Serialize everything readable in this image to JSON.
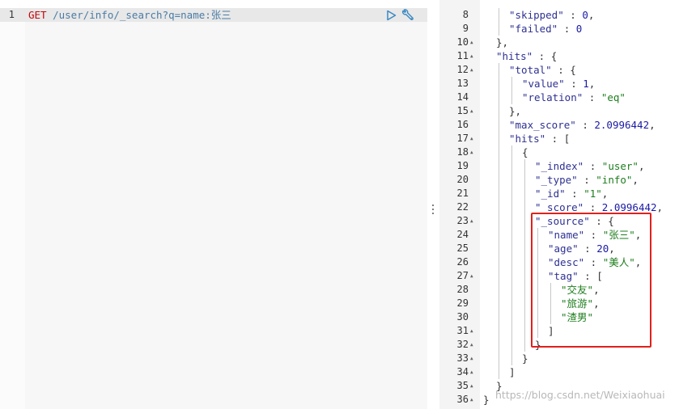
{
  "request": {
    "line_number": "1",
    "method": "GET",
    "path": " /user/info/_search?q=name:张三"
  },
  "icons": {
    "run": "play-icon",
    "settings": "wrench-icon"
  },
  "response": {
    "lines": [
      {
        "n": "8",
        "fold": false,
        "indent": 1,
        "tokens": [
          {
            "t": "\"skipped\"",
            "c": "key"
          },
          {
            "t": " : ",
            "c": "punc"
          },
          {
            "t": "0",
            "c": "num"
          },
          {
            "t": ",",
            "c": "punc"
          }
        ]
      },
      {
        "n": "9",
        "fold": false,
        "indent": 1,
        "tokens": [
          {
            "t": "\"failed\"",
            "c": "key"
          },
          {
            "t": " : ",
            "c": "punc"
          },
          {
            "t": "0",
            "c": "num"
          }
        ]
      },
      {
        "n": "10",
        "fold": true,
        "indent": 0,
        "tokens": [
          {
            "t": "},",
            "c": "punc"
          }
        ]
      },
      {
        "n": "11",
        "fold": true,
        "indent": 0,
        "tokens": [
          {
            "t": "\"hits\"",
            "c": "key"
          },
          {
            "t": " : {",
            "c": "punc"
          }
        ]
      },
      {
        "n": "12",
        "fold": true,
        "indent": 1,
        "tokens": [
          {
            "t": "\"total\"",
            "c": "key"
          },
          {
            "t": " : {",
            "c": "punc"
          }
        ]
      },
      {
        "n": "13",
        "fold": false,
        "indent": 2,
        "tokens": [
          {
            "t": "\"value\"",
            "c": "key"
          },
          {
            "t": " : ",
            "c": "punc"
          },
          {
            "t": "1",
            "c": "num"
          },
          {
            "t": ",",
            "c": "punc"
          }
        ]
      },
      {
        "n": "14",
        "fold": false,
        "indent": 2,
        "tokens": [
          {
            "t": "\"relation\"",
            "c": "key"
          },
          {
            "t": " : ",
            "c": "punc"
          },
          {
            "t": "\"eq\"",
            "c": "str"
          }
        ]
      },
      {
        "n": "15",
        "fold": true,
        "indent": 1,
        "tokens": [
          {
            "t": "},",
            "c": "punc"
          }
        ]
      },
      {
        "n": "16",
        "fold": false,
        "indent": 1,
        "tokens": [
          {
            "t": "\"max_score\"",
            "c": "key"
          },
          {
            "t": " : ",
            "c": "punc"
          },
          {
            "t": "2.0996442",
            "c": "num"
          },
          {
            "t": ",",
            "c": "punc"
          }
        ]
      },
      {
        "n": "17",
        "fold": true,
        "indent": 1,
        "tokens": [
          {
            "t": "\"hits\"",
            "c": "key"
          },
          {
            "t": " : [",
            "c": "punc"
          }
        ]
      },
      {
        "n": "18",
        "fold": true,
        "indent": 2,
        "tokens": [
          {
            "t": "{",
            "c": "punc"
          }
        ]
      },
      {
        "n": "19",
        "fold": false,
        "indent": 3,
        "tokens": [
          {
            "t": "\"_index\"",
            "c": "key"
          },
          {
            "t": " : ",
            "c": "punc"
          },
          {
            "t": "\"user\"",
            "c": "str"
          },
          {
            "t": ",",
            "c": "punc"
          }
        ]
      },
      {
        "n": "20",
        "fold": false,
        "indent": 3,
        "tokens": [
          {
            "t": "\"_type\"",
            "c": "key"
          },
          {
            "t": " : ",
            "c": "punc"
          },
          {
            "t": "\"info\"",
            "c": "str"
          },
          {
            "t": ",",
            "c": "punc"
          }
        ]
      },
      {
        "n": "21",
        "fold": false,
        "indent": 3,
        "tokens": [
          {
            "t": "\"_id\"",
            "c": "key"
          },
          {
            "t": " : ",
            "c": "punc"
          },
          {
            "t": "\"1\"",
            "c": "str"
          },
          {
            "t": ",",
            "c": "punc"
          }
        ]
      },
      {
        "n": "22",
        "fold": false,
        "indent": 3,
        "tokens": [
          {
            "t": "\"_score\"",
            "c": "key"
          },
          {
            "t": " : ",
            "c": "punc"
          },
          {
            "t": "2.0996442",
            "c": "num"
          },
          {
            "t": ",",
            "c": "punc"
          }
        ]
      },
      {
        "n": "23",
        "fold": true,
        "indent": 3,
        "tokens": [
          {
            "t": "\"_source\"",
            "c": "key"
          },
          {
            "t": " : {",
            "c": "punc"
          }
        ]
      },
      {
        "n": "24",
        "fold": false,
        "indent": 4,
        "tokens": [
          {
            "t": "\"name\"",
            "c": "key"
          },
          {
            "t": " : ",
            "c": "punc"
          },
          {
            "t": "\"张三\"",
            "c": "str"
          },
          {
            "t": ",",
            "c": "punc"
          }
        ]
      },
      {
        "n": "25",
        "fold": false,
        "indent": 4,
        "tokens": [
          {
            "t": "\"age\"",
            "c": "key"
          },
          {
            "t": " : ",
            "c": "punc"
          },
          {
            "t": "20",
            "c": "num"
          },
          {
            "t": ",",
            "c": "punc"
          }
        ]
      },
      {
        "n": "26",
        "fold": false,
        "indent": 4,
        "tokens": [
          {
            "t": "\"desc\"",
            "c": "key"
          },
          {
            "t": " : ",
            "c": "punc"
          },
          {
            "t": "\"美人\"",
            "c": "str"
          },
          {
            "t": ",",
            "c": "punc"
          }
        ]
      },
      {
        "n": "27",
        "fold": true,
        "indent": 4,
        "tokens": [
          {
            "t": "\"tag\"",
            "c": "key"
          },
          {
            "t": " : [",
            "c": "punc"
          }
        ]
      },
      {
        "n": "28",
        "fold": false,
        "indent": 5,
        "tokens": [
          {
            "t": "\"交友\"",
            "c": "str"
          },
          {
            "t": ",",
            "c": "punc"
          }
        ]
      },
      {
        "n": "29",
        "fold": false,
        "indent": 5,
        "tokens": [
          {
            "t": "\"旅游\"",
            "c": "str"
          },
          {
            "t": ",",
            "c": "punc"
          }
        ]
      },
      {
        "n": "30",
        "fold": false,
        "indent": 5,
        "tokens": [
          {
            "t": "\"渣男\"",
            "c": "str"
          }
        ]
      },
      {
        "n": "31",
        "fold": true,
        "indent": 4,
        "tokens": [
          {
            "t": "]",
            "c": "punc"
          }
        ]
      },
      {
        "n": "32",
        "fold": true,
        "indent": 3,
        "tokens": [
          {
            "t": "}",
            "c": "punc"
          }
        ]
      },
      {
        "n": "33",
        "fold": true,
        "indent": 2,
        "tokens": [
          {
            "t": "}",
            "c": "punc"
          }
        ]
      },
      {
        "n": "34",
        "fold": true,
        "indent": 1,
        "tokens": [
          {
            "t": "]",
            "c": "punc"
          }
        ]
      },
      {
        "n": "35",
        "fold": true,
        "indent": 0,
        "tokens": [
          {
            "t": "}",
            "c": "punc"
          }
        ]
      },
      {
        "n": "36",
        "fold": true,
        "indent": -1,
        "tokens": [
          {
            "t": "}",
            "c": "punc"
          }
        ]
      }
    ]
  },
  "watermark": "https://blog.csdn.net/Weixiaohuai",
  "colors": {
    "method": "#c5060b",
    "path": "#4a7ba5",
    "json_key": "#2e3191",
    "json_string": "#1e7d1e",
    "json_number": "#1a1aa6",
    "highlight_border": "#e0211b",
    "run_icon": "#3a89c4"
  }
}
